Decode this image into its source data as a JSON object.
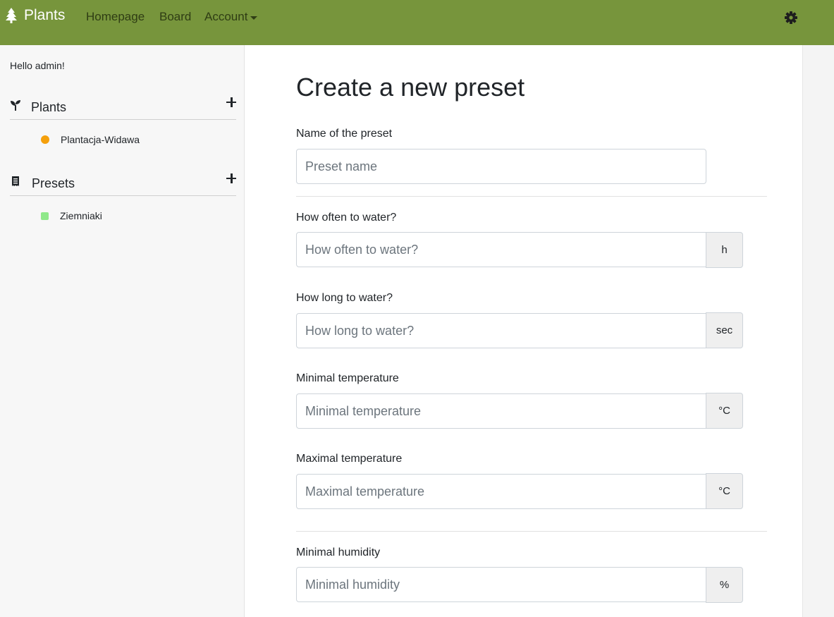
{
  "navbar": {
    "brand": "Plants",
    "links": [
      "Homepage",
      "Board",
      "Account"
    ]
  },
  "sidebar": {
    "greeting": "Hello admin!",
    "plants": {
      "title": "Plants",
      "items": [
        {
          "label": "Plantacja-Widawa",
          "status_color": "#f5a00b"
        }
      ]
    },
    "presets": {
      "title": "Presets",
      "items": [
        {
          "label": "Ziemniaki",
          "status_color": "#8fe88a"
        }
      ]
    }
  },
  "form": {
    "title": "Create a new preset",
    "fields": [
      {
        "label": "Name of the preset",
        "placeholder": "Preset name",
        "value": "",
        "unit": ""
      },
      {
        "label": "How often to water?",
        "placeholder": "How often to water?",
        "value": "",
        "unit": "h"
      },
      {
        "label": "How long to water?",
        "placeholder": "How long to water?",
        "value": "",
        "unit": "sec"
      },
      {
        "label": "Minimal temperature",
        "placeholder": "Minimal temperature",
        "value": "",
        "unit": "°C"
      },
      {
        "label": "Maximal temperature",
        "placeholder": "Maximal temperature",
        "value": "",
        "unit": "°C"
      },
      {
        "label": "Minimal humidity",
        "placeholder": "Minimal humidity",
        "value": "",
        "unit": "%"
      }
    ]
  },
  "colors": {
    "navbar": "#77953c",
    "nav_link": "#2f3d14",
    "sidebar_bg": "#f7f7f7"
  }
}
